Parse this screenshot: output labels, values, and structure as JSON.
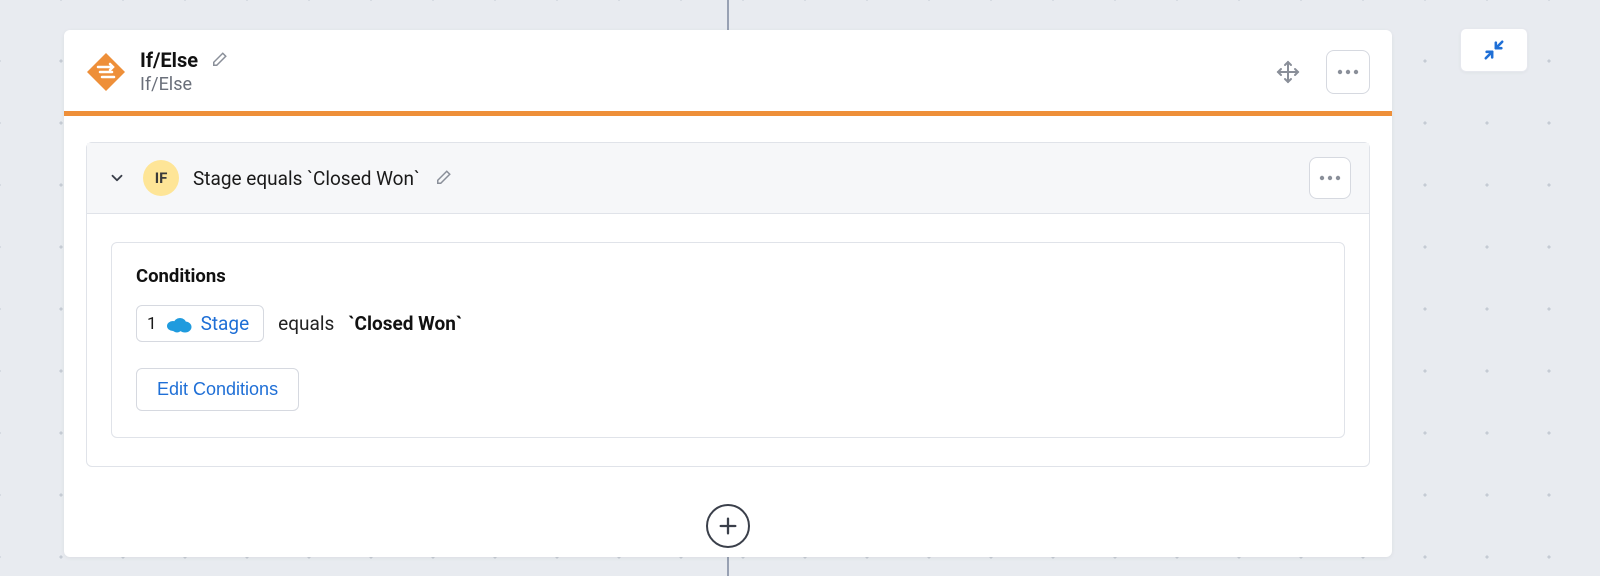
{
  "colors": {
    "accent": "#ee8f39",
    "link": "#1f6fd6",
    "badge_bg": "#fee597"
  },
  "block": {
    "title": "If/Else",
    "subtitle": "If/Else"
  },
  "branch": {
    "badge": "IF",
    "title": "Stage equals `Closed Won`",
    "conditions_label": "Conditions",
    "condition": {
      "index": "1",
      "field": "Stage",
      "operator": "equals",
      "value": "`Closed Won`"
    },
    "edit_button": "Edit Conditions"
  }
}
